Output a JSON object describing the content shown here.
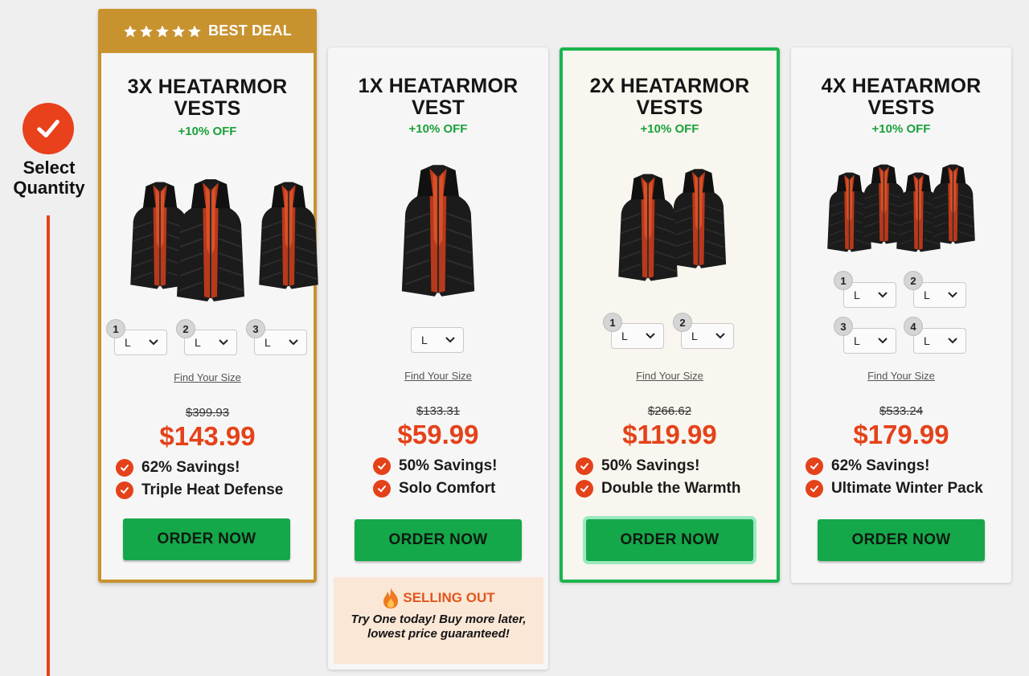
{
  "step": {
    "icon": "checkmark-icon",
    "label_line1": "Select",
    "label_line2": "Quantity",
    "accent": "#e8411c"
  },
  "cards": [
    {
      "badge": "BEST DEAL",
      "title_line1": "3X HEATARMOR",
      "title_line2": "VESTS",
      "discount": "+10% OFF",
      "sizes": [
        {
          "num": "1",
          "value": "L"
        },
        {
          "num": "2",
          "value": "L"
        },
        {
          "num": "3",
          "value": "L"
        }
      ],
      "find_size": "Find Your Size",
      "old_price": "$399.93",
      "price": "$143.99",
      "features": [
        "62% Savings!",
        "Triple Heat Defense"
      ],
      "order": "ORDER NOW"
    },
    {
      "title_line1": "1X HEATARMOR",
      "title_line2": "VEST",
      "discount": "+10% OFF",
      "sizes": [
        {
          "value": "L"
        }
      ],
      "find_size": "Find Your Size",
      "old_price": "$133.31",
      "price": "$59.99",
      "features": [
        "50% Savings!",
        "Solo Comfort"
      ],
      "order": "ORDER NOW"
    },
    {
      "title_line1": "2X HEATARMOR",
      "title_line2": "VESTS",
      "discount": "+10% OFF",
      "sizes": [
        {
          "num": "1",
          "value": "L"
        },
        {
          "num": "2",
          "value": "L"
        }
      ],
      "find_size": "Find Your Size",
      "old_price": "$266.62",
      "price": "$119.99",
      "features": [
        "50% Savings!",
        "Double the Warmth"
      ],
      "order": "ORDER NOW"
    },
    {
      "title_line1": "4X HEATARMOR",
      "title_line2": "VESTS",
      "discount": "+10% OFF",
      "sizes": [
        {
          "num": "1",
          "value": "L"
        },
        {
          "num": "2",
          "value": "L"
        },
        {
          "num": "3",
          "value": "L"
        },
        {
          "num": "4",
          "value": "L"
        }
      ],
      "find_size": "Find Your Size",
      "old_price": "$533.24",
      "price": "$179.99",
      "features": [
        "62% Savings!",
        "Ultimate Winter Pack"
      ],
      "order": "ORDER NOW"
    }
  ],
  "selling_out": {
    "icon": "flame-icon",
    "heading": "SELLING OUT",
    "text": "Try One today! Buy more later, lowest price guaranteed!"
  },
  "colors": {
    "featured_border": "#c8932f",
    "selected_border": "#1cb44e",
    "price": "#e4421a",
    "discount": "#1aa13a",
    "order_button": "#15a84a"
  }
}
